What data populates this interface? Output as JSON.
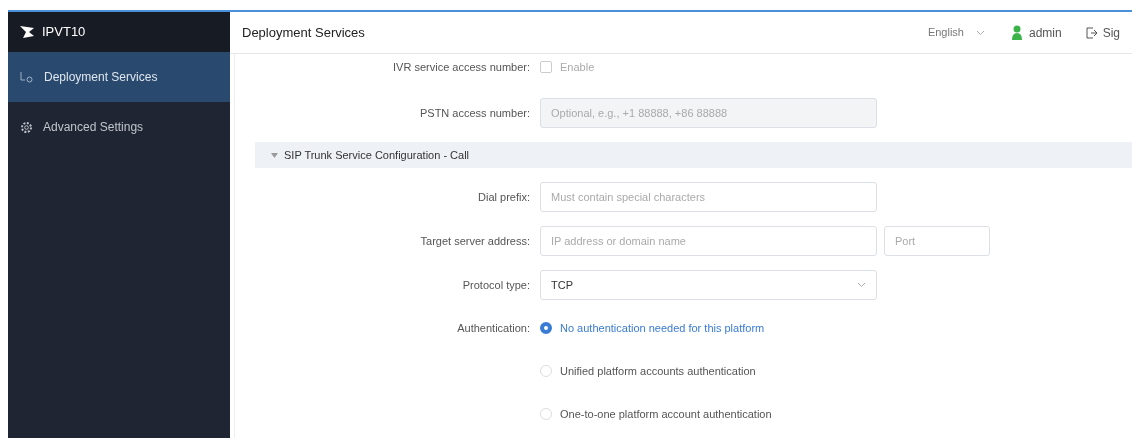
{
  "sidebar": {
    "brand": "IPVT10",
    "items": [
      {
        "label": "Deployment Services",
        "kind": "deploy",
        "selected": true
      },
      {
        "label": "Advanced Settings",
        "kind": "gear",
        "selected": false
      }
    ]
  },
  "header": {
    "title": "Deployment Services",
    "language": "English",
    "user": "admin",
    "signout": "Sig"
  },
  "form": {
    "ivr": {
      "label": "IVR service access number:",
      "option": "Enable",
      "checked": false
    },
    "pstn": {
      "label": "PSTN access number:",
      "placeholder": "Optional, e.g., +1 88888, +86 88888",
      "disabled": true
    },
    "section": {
      "title": "SIP Trunk Service Configuration - Call",
      "expanded": true
    },
    "dial_prefix": {
      "label": "Dial prefix:",
      "placeholder": "Must contain special characters"
    },
    "target": {
      "label": "Target server address:",
      "placeholder": "IP address or domain name",
      "port_placeholder": "Port"
    },
    "protocol": {
      "label": "Protocol type:",
      "value": "TCP"
    },
    "authentication": {
      "label": "Authentication:",
      "options": [
        {
          "label": "No authentication needed for this platform",
          "selected": true
        },
        {
          "label": "Unified platform accounts authentication",
          "selected": false
        },
        {
          "label": "One-to-one platform account authentication",
          "selected": false
        }
      ]
    }
  }
}
